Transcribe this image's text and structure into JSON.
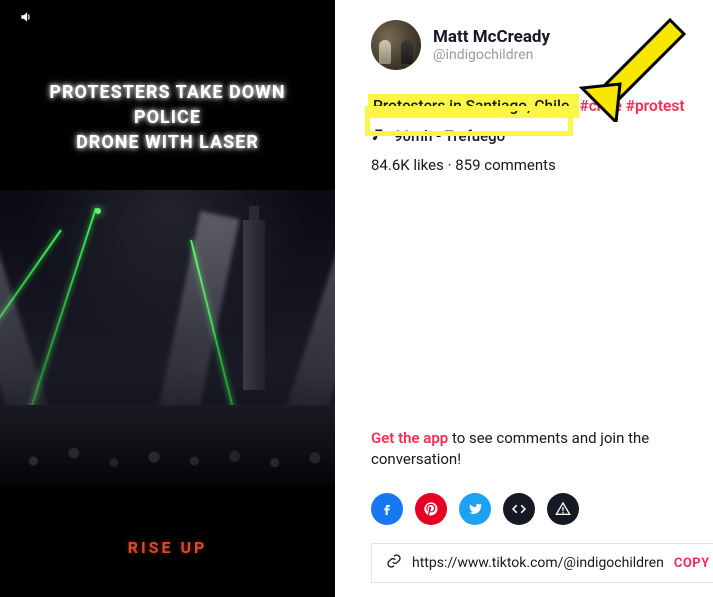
{
  "video": {
    "overlay_line1": "PROTESTERS TAKE DOWN POLICE",
    "overlay_line2": "DRONE WITH LASER",
    "bottom_watermark": "RISE UP",
    "sound_icon": "sound-on"
  },
  "author": {
    "display_name": "Matt McCready",
    "handle": "@indigochildren"
  },
  "post": {
    "caption": "Protesters in Santiago, Chile.",
    "hashtags": [
      "#chile",
      "#protest"
    ],
    "music": "90mh - Trefuego",
    "likes_label": "84.6K likes",
    "comments_label": "859 comments"
  },
  "cta": {
    "link_text": "Get the app",
    "rest_text": " to see comments and join the conversation!"
  },
  "share": {
    "facebook": "facebook",
    "pinterest": "pinterest",
    "twitter": "twitter",
    "embed": "embed",
    "report": "report"
  },
  "permalink": {
    "url": "https://www.tiktok.com/@indigochildren",
    "copy_label": "COPY"
  },
  "annotations": {
    "highlight_target": "caption",
    "arrow_color": "#f7e600",
    "arrow_stroke": "#000000"
  }
}
